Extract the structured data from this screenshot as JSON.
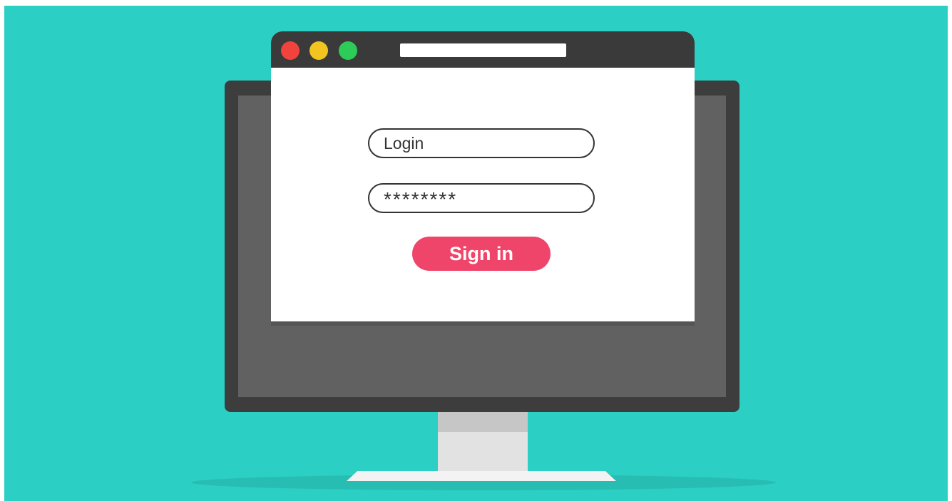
{
  "login_form": {
    "username_value": "Login",
    "password_value": "********",
    "signin_label": "Sign in"
  },
  "colors": {
    "background": "#2ccfc4",
    "signin_button": "#f0456a",
    "window_close": "#f0433e",
    "window_minimize": "#f1c41f",
    "window_maximize": "#2dcc59"
  },
  "icons": {
    "close": "red-dot-icon",
    "minimize": "yellow-dot-icon",
    "maximize": "green-dot-icon"
  }
}
